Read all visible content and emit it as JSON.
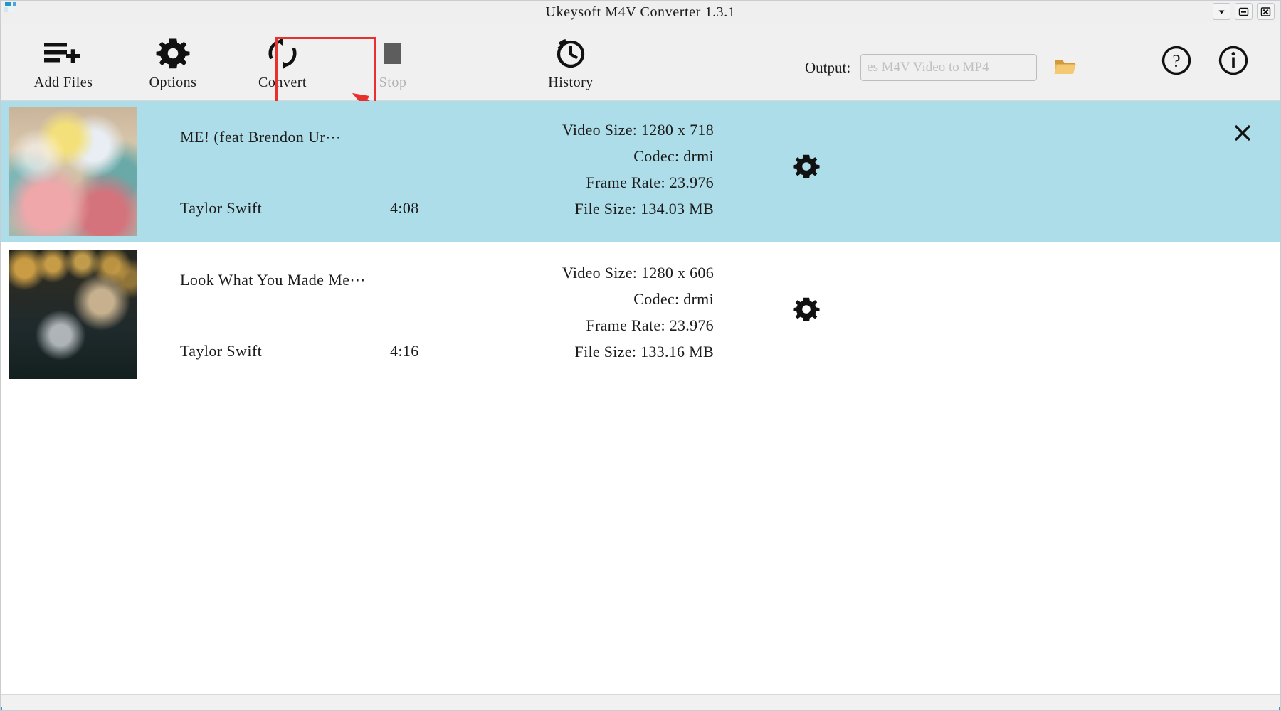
{
  "window": {
    "title": "Ukeysoft M4V Converter 1.3.1",
    "logo_icon": "app-logo-icon",
    "buttons": [
      {
        "name": "dropdown-menu-button",
        "icon": "chevron-down-icon",
        "label": "▼"
      },
      {
        "name": "minimize-button",
        "icon": "minimize-icon",
        "label": "–"
      },
      {
        "name": "close-button",
        "icon": "close-window-icon",
        "label": "✕"
      }
    ]
  },
  "toolbar": {
    "add_files": {
      "label": "Add Files",
      "icon": "add-files-icon",
      "enabled": true
    },
    "options": {
      "label": "Options",
      "icon": "gear-icon",
      "enabled": true
    },
    "convert": {
      "label": "Convert",
      "icon": "convert-refresh-icon",
      "enabled": true
    },
    "stop": {
      "label": "Stop",
      "icon": "stop-square-icon",
      "enabled": false
    },
    "history": {
      "label": "History",
      "icon": "history-clock-icon",
      "enabled": true
    },
    "output_label": "Output:",
    "output_path_value": "es M4V Video to MP4",
    "browse_icon": "folder-open-icon",
    "help_icon": "question-mark-circle-icon",
    "about_icon": "info-circle-icon",
    "annotation_color": "#e8302f",
    "annotated_button": "Convert"
  },
  "file_list": {
    "meta_labels": {
      "video_size": "Video Size:",
      "codec": "Codec:",
      "frame_rate": "Frame Rate:",
      "file_size": "File Size:"
    },
    "rows": [
      {
        "title": "ME! (feat  Brendon Ur⋯",
        "artist": "Taylor Swift",
        "duration": "4:08",
        "video_size": "1280 x 718",
        "codec": "drmi",
        "frame_rate": "23.976",
        "file_size": "134.03 MB",
        "selected": true,
        "settings_icon": "gear-icon",
        "remove_icon": "remove-x-icon",
        "thumbnail": "thumb-1"
      },
      {
        "title": "Look What You Made Me⋯",
        "artist": "Taylor Swift",
        "duration": "4:16",
        "video_size": "1280 x 606",
        "codec": "drmi",
        "frame_rate": "23.976",
        "file_size": "133.16 MB",
        "selected": false,
        "settings_icon": "gear-icon",
        "remove_icon": "remove-x-icon",
        "thumbnail": "thumb-2"
      }
    ]
  },
  "colors": {
    "selected_row": "#addde8",
    "toolbar_bg": "#f0f0f0",
    "titlebar_bg": "#efefef",
    "annotation_red": "#e8302f",
    "disabled_text": "#b3b3b3"
  },
  "status_bar": {
    "text": ""
  }
}
